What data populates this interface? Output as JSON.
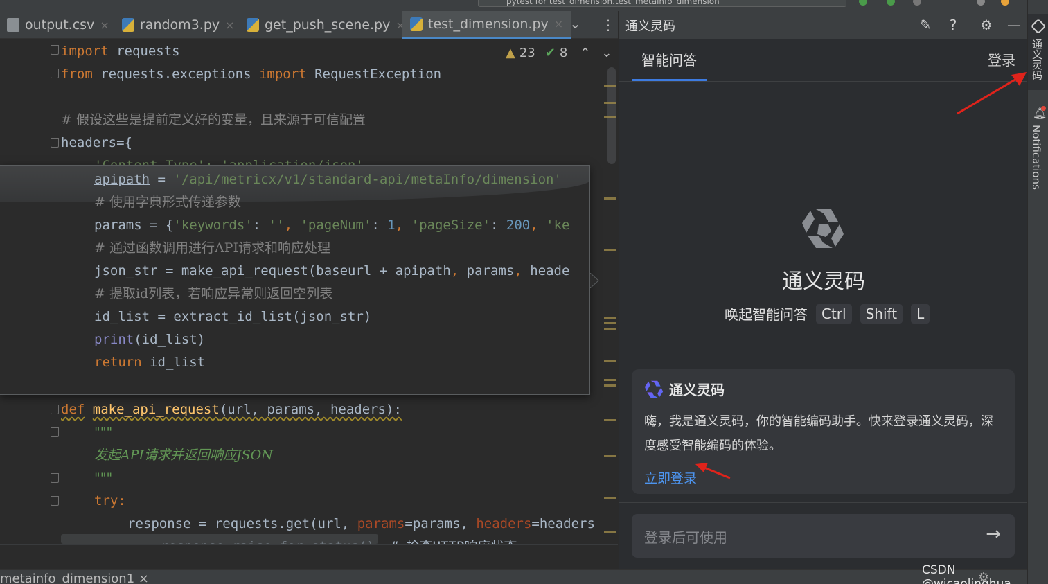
{
  "toolbar": {
    "run_config": "pytest for test_dimension.test_metainfo_dimension"
  },
  "tabs": [
    {
      "label": "output.csv",
      "icon": "csv-file-icon"
    },
    {
      "label": "random3.py",
      "icon": "python-file-icon"
    },
    {
      "label": "get_push_scene.py",
      "icon": "python-file-icon"
    },
    {
      "label": "test_dimension.py",
      "icon": "python-file-icon",
      "active": true
    }
  ],
  "inspections": {
    "warnings": "23",
    "ok": "8"
  },
  "editor": {
    "lines": {
      "l1a": "import",
      "l1b": " requests",
      "l2a": "from",
      "l2b": " requests.exceptions ",
      "l2c": "import",
      "l2d": " RequestException",
      "l3": "# 假设这些是提前定义好的变量，且来源于可信配置",
      "l4": "headers={",
      "l5": "'Content-Type': 'application/json'",
      "l6": "def",
      "l6b": "make_api_request",
      "l6c": "(url, params, headers):",
      "l7": "\"\"\"",
      "l8": "发起API请求并返回响应JSON",
      "l9": "\"\"\"",
      "l10": "try:",
      "l11a": "response = requests.get(url, ",
      "l11b": "params",
      "l11c": "=params, ",
      "l11d": "headers",
      "l11e": "=headers",
      "l12": "response.raise_for_status()  # 检查HTTP响应状态"
    },
    "popup": {
      "p1a": "apipath",
      "p1b": " = ",
      "p1c": "'/api/metricx/v1/standard-api/metaInfo/dimension'",
      "p2": "# 使用字典形式传递参数",
      "p3a": "params = {",
      "p3b": "'keywords'",
      "p3c": ": ",
      "p3d": "''",
      "p3e": ", ",
      "p3f": "'pageNum'",
      "p3g": ": ",
      "p3h": "1",
      "p3i": ", ",
      "p3j": "'pageSize'",
      "p3k": ": ",
      "p3l": "200",
      "p3m": ", ",
      "p3n": "'ke",
      "p4": "# 通过函数调用进行API请求和响应处理",
      "p5a": "json_str = make_api_request(baseurl + apipath",
      "p5b": ", ",
      "p5c": "params",
      "p5d": ", ",
      "p5e": "heade",
      "p6": "# 提取id列表，若响应异常则返回空列表",
      "p7": "id_list = extract_id_list(json_str)",
      "p8a": "print",
      "p8b": "(id_list)",
      "p9a": "return",
      "p9b": " id_list"
    }
  },
  "bottom": {
    "tab_label": "metainfo_dimension1 ×"
  },
  "panel": {
    "title": "通义灵码",
    "tab_qa": "智能问答",
    "login_top": "登录",
    "brand": "通义灵码",
    "shortcut_label": "唤起智能问答",
    "keys": [
      "Ctrl",
      "Shift",
      "L"
    ],
    "card": {
      "title": "通义灵码",
      "body": "嗨，我是通义灵码，你的智能编码助手。快来登录通义灵码，深度感受智能编码的体验。",
      "link": "立即登录"
    },
    "input_placeholder": "登录后可使用",
    "send": "→"
  },
  "strip": {
    "tongyi": "通义灵码",
    "notifications": "Notifications"
  },
  "watermark": "CSDN @wjcaolinghua",
  "colors": {
    "accent": "#3d7be0",
    "annotation_arrow": "#e0231b",
    "link": "#4d95f0"
  }
}
